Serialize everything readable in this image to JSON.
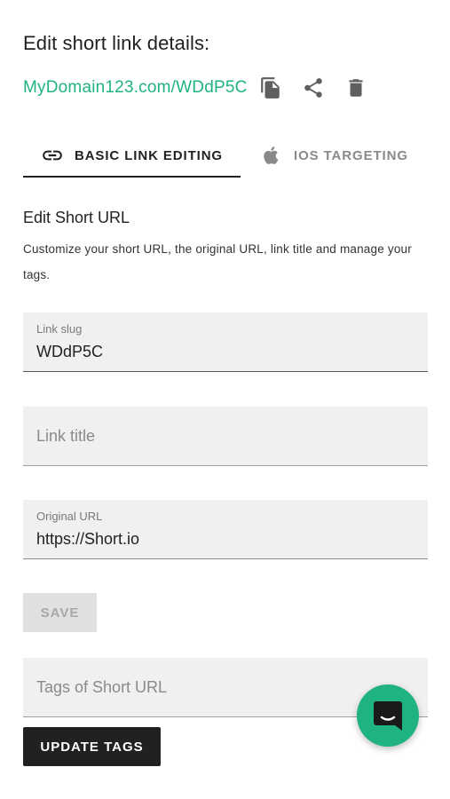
{
  "header": {
    "title": "Edit short link details:",
    "short_link": "MyDomain123.com/WDdP5C",
    "link_color": "#1fb37f",
    "actions": [
      {
        "name": "copy",
        "icon": "copy-icon"
      },
      {
        "name": "share",
        "icon": "share-icon"
      },
      {
        "name": "delete",
        "icon": "trash-icon"
      }
    ]
  },
  "tabs": [
    {
      "label": "BASIC LINK EDITING",
      "icon": "link-icon",
      "active": true
    },
    {
      "label": "IOS TARGETING",
      "icon": "apple-icon",
      "active": false
    }
  ],
  "section": {
    "title": "Edit Short URL",
    "description": "Customize your short URL, the original URL, link title and manage your tags."
  },
  "form": {
    "slug": {
      "label": "Link slug",
      "value": "WDdP5C"
    },
    "title": {
      "placeholder": "Link title",
      "value": ""
    },
    "original_url": {
      "label": "Original URL",
      "value": "https://Short.io"
    },
    "save_label": "SAVE",
    "tags": {
      "placeholder": "Tags of Short URL",
      "value": ""
    },
    "update_tags_label": "UPDATE TAGS"
  },
  "chat": {
    "icon": "chat-icon",
    "accent": "#1fb37f"
  }
}
